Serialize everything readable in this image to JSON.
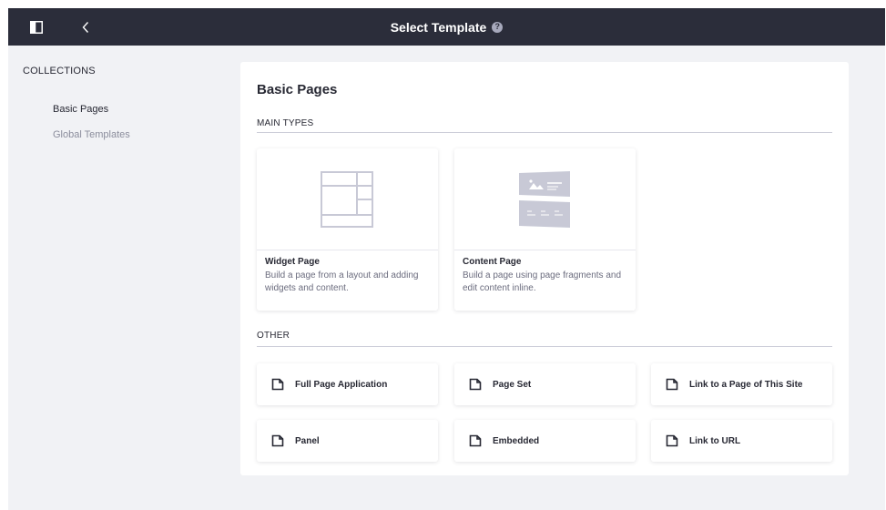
{
  "header": {
    "title": "Select Template",
    "help_icon": "question-circle-icon",
    "help_glyph": "?",
    "toggle_icon": "sidebar-toggle-icon",
    "back_icon": "chevron-left-icon"
  },
  "sidebar": {
    "heading": "COLLECTIONS",
    "items": [
      {
        "label": "Basic Pages",
        "active": true
      },
      {
        "label": "Global Templates",
        "active": false
      }
    ]
  },
  "main": {
    "title": "Basic Pages",
    "main_types": {
      "label": "MAIN TYPES",
      "cards": [
        {
          "title": "Widget Page",
          "description": "Build a page from a layout and adding widgets and content.",
          "thumbnail": "widget-layout-icon"
        },
        {
          "title": "Content Page",
          "description": "Build a page using page fragments and edit content inline.",
          "thumbnail": "content-fragments-icon"
        }
      ]
    },
    "other": {
      "label": "OTHER",
      "cards": [
        {
          "label": "Full Page Application",
          "icon": "page-icon"
        },
        {
          "label": "Page Set",
          "icon": "page-icon"
        },
        {
          "label": "Link to a Page of This Site",
          "icon": "page-icon"
        },
        {
          "label": "Panel",
          "icon": "page-icon"
        },
        {
          "label": "Embedded",
          "icon": "page-icon"
        },
        {
          "label": "Link to URL",
          "icon": "page-icon"
        }
      ]
    }
  },
  "colors": {
    "topbar": "#2b2d3a",
    "background": "#f1f2f5",
    "card": "#ffffff",
    "text_primary": "#272833",
    "text_secondary": "#6b6c7e",
    "thumbnail_stroke": "#c8c9d6"
  }
}
